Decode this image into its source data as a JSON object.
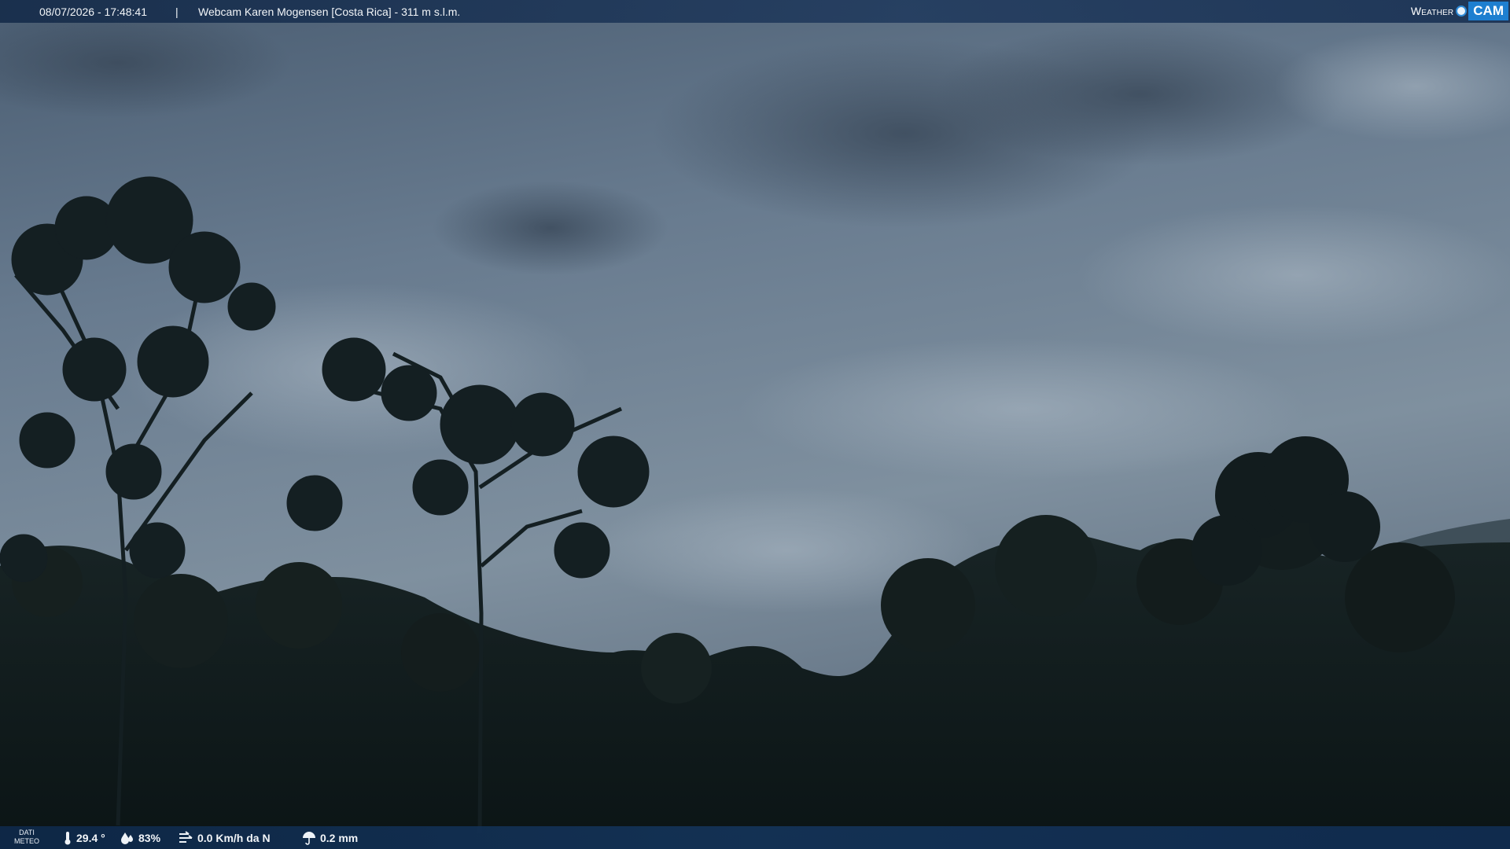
{
  "overlay": {
    "timestamp": "08/07/2026 - 17:48:41",
    "separator": "|",
    "camera_title": "Webcam Karen Mogensen [Costa Rica]  - 311 m s.l.m.",
    "logo": {
      "word": "Weather",
      "badge": "CAM"
    }
  },
  "weather_bar": {
    "label_line1": "DATI",
    "label_line2": "METEO",
    "temperature": "29.4 °",
    "humidity": "83%",
    "wind": "0.0 Km/h da N",
    "rain": "0.2 mm"
  },
  "icons": {
    "temperature": "thermometer-icon",
    "humidity": "humidity-drop-icon",
    "wind": "wind-icon",
    "rain": "umbrella-icon"
  },
  "colors": {
    "bar": "#16345a",
    "logo_accent": "#1e7fd0",
    "sky": "#6b7d90",
    "foliage": "#0f1a1c"
  }
}
